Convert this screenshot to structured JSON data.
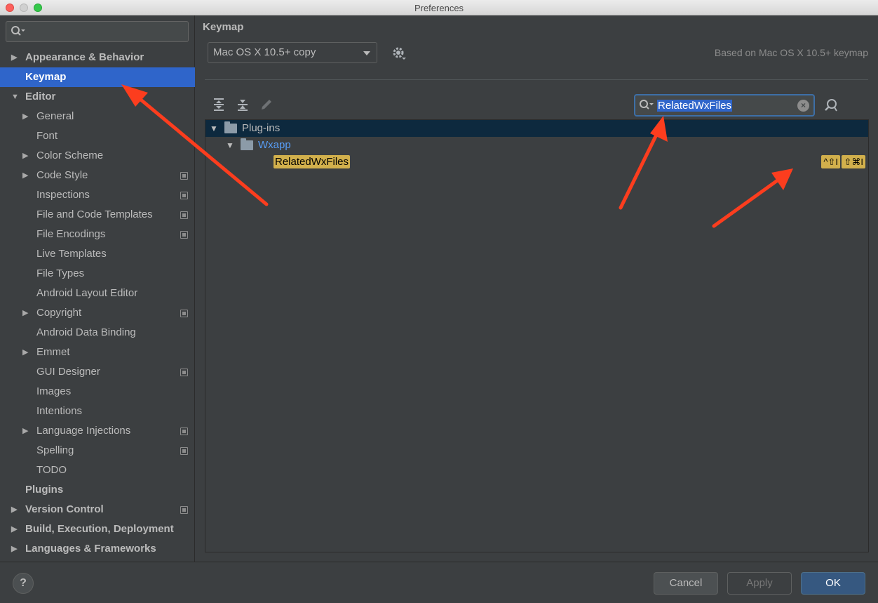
{
  "window": {
    "title": "Preferences"
  },
  "sidebar": {
    "search_placeholder": "",
    "items": [
      {
        "label": "Appearance & Behavior",
        "level": 0,
        "expandable": true,
        "expanded": false,
        "bold": true,
        "project_scoped": false
      },
      {
        "label": "Keymap",
        "level": 0,
        "expandable": false,
        "bold": true,
        "selected": true,
        "project_scoped": false
      },
      {
        "label": "Editor",
        "level": 0,
        "expandable": true,
        "expanded": true,
        "bold": true,
        "project_scoped": false
      },
      {
        "label": "General",
        "level": 1,
        "expandable": true,
        "expanded": false,
        "project_scoped": false
      },
      {
        "label": "Font",
        "level": 1,
        "expandable": false,
        "project_scoped": false
      },
      {
        "label": "Color Scheme",
        "level": 1,
        "expandable": true,
        "expanded": false,
        "project_scoped": false
      },
      {
        "label": "Code Style",
        "level": 1,
        "expandable": true,
        "expanded": false,
        "project_scoped": true
      },
      {
        "label": "Inspections",
        "level": 1,
        "expandable": false,
        "project_scoped": true
      },
      {
        "label": "File and Code Templates",
        "level": 1,
        "expandable": false,
        "project_scoped": true
      },
      {
        "label": "File Encodings",
        "level": 1,
        "expandable": false,
        "project_scoped": true
      },
      {
        "label": "Live Templates",
        "level": 1,
        "expandable": false,
        "project_scoped": false
      },
      {
        "label": "File Types",
        "level": 1,
        "expandable": false,
        "project_scoped": false
      },
      {
        "label": "Android Layout Editor",
        "level": 1,
        "expandable": false,
        "project_scoped": false
      },
      {
        "label": "Copyright",
        "level": 1,
        "expandable": true,
        "expanded": false,
        "project_scoped": true
      },
      {
        "label": "Android Data Binding",
        "level": 1,
        "expandable": false,
        "project_scoped": false
      },
      {
        "label": "Emmet",
        "level": 1,
        "expandable": true,
        "expanded": false,
        "project_scoped": false
      },
      {
        "label": "GUI Designer",
        "level": 1,
        "expandable": false,
        "project_scoped": true
      },
      {
        "label": "Images",
        "level": 1,
        "expandable": false,
        "project_scoped": false
      },
      {
        "label": "Intentions",
        "level": 1,
        "expandable": false,
        "project_scoped": false
      },
      {
        "label": "Language Injections",
        "level": 1,
        "expandable": true,
        "expanded": false,
        "project_scoped": true
      },
      {
        "label": "Spelling",
        "level": 1,
        "expandable": false,
        "project_scoped": true
      },
      {
        "label": "TODO",
        "level": 1,
        "expandable": false,
        "project_scoped": false
      },
      {
        "label": "Plugins",
        "level": 0,
        "expandable": false,
        "bold": true,
        "project_scoped": false
      },
      {
        "label": "Version Control",
        "level": 0,
        "expandable": true,
        "expanded": false,
        "bold": true,
        "project_scoped": true
      },
      {
        "label": "Build, Execution, Deployment",
        "level": 0,
        "expandable": true,
        "expanded": false,
        "bold": true,
        "project_scoped": false
      },
      {
        "label": "Languages & Frameworks",
        "level": 0,
        "expandable": true,
        "expanded": false,
        "bold": true,
        "project_scoped": false
      }
    ]
  },
  "main": {
    "title": "Keymap",
    "keymap_select": {
      "value": "Mac OS X 10.5+ copy"
    },
    "based_on": "Based on Mac OS X 10.5+ keymap",
    "search": {
      "value": "RelatedWxFiles"
    },
    "tree": [
      {
        "label": "Plug-ins",
        "level": 0,
        "kind": "folder",
        "expanded": true,
        "selected": true
      },
      {
        "label": "Wxapp",
        "level": 1,
        "kind": "folder",
        "expanded": true,
        "color": "#589df6"
      },
      {
        "label": "RelatedWxFiles",
        "level": 2,
        "kind": "action",
        "highlighted": true,
        "shortcuts": [
          "^⇧I",
          "⇧⌘I"
        ]
      }
    ]
  },
  "footer": {
    "help_label": "?",
    "cancel_label": "Cancel",
    "apply_label": "Apply",
    "ok_label": "OK"
  },
  "colors": {
    "selection": "#2f65ca",
    "search_highlight": "#d2b04c",
    "annotation_arrow": "#fc3d1e",
    "link_blue": "#589df6"
  }
}
